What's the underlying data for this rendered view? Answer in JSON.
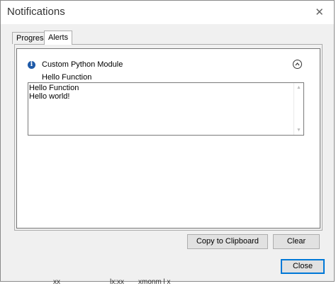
{
  "window": {
    "title": "Notifications",
    "close_glyph": "✕"
  },
  "tabs": [
    {
      "label": "Progress"
    },
    {
      "label": "Alerts",
      "active": true
    }
  ],
  "alert": {
    "icon": "info-icon",
    "module": "Custom Python Module",
    "function": "Hello Function",
    "output": "Hello Function\nHello world!"
  },
  "buttons": {
    "copy": "Copy to Clipboard",
    "clear": "Clear",
    "close": "Close"
  },
  "background_fragments": [
    "xx",
    "lx:xx",
    "xmonm l x"
  ],
  "colors": {
    "accent": "#0078d7",
    "info_icon": "#1f5aa8"
  }
}
